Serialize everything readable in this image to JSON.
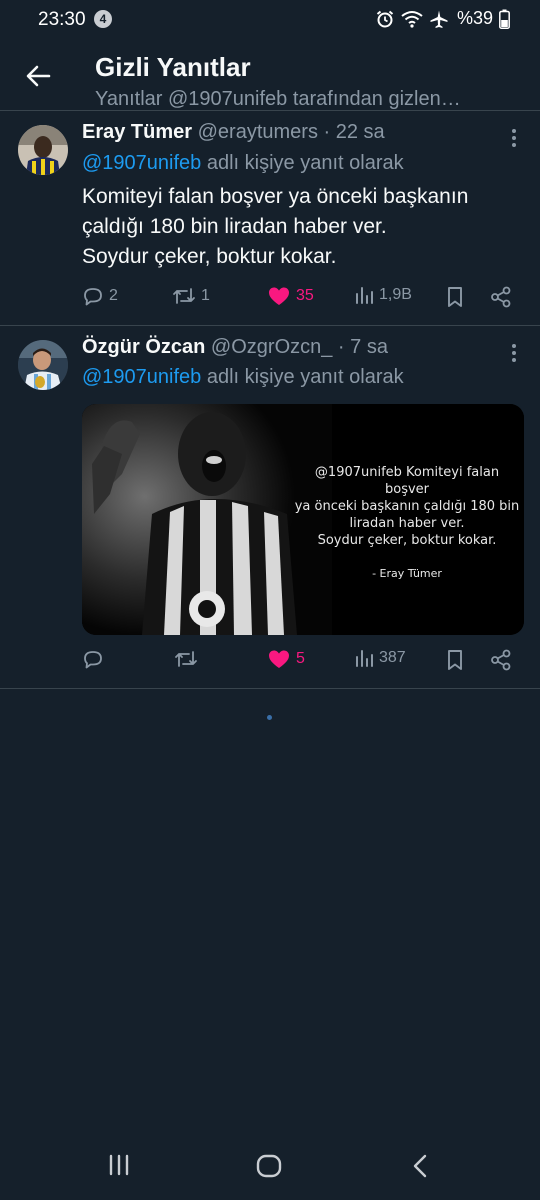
{
  "status_bar": {
    "time": "23:30",
    "notification_count": "4",
    "battery": "%39",
    "icons": [
      "alarm-icon",
      "wifi-icon",
      "airplane-icon",
      "battery-icon"
    ]
  },
  "header": {
    "title": "Gizli Yanıtlar",
    "subtitle": "Yanıtlar @1907unifeb tarafından gizlen…"
  },
  "tweets": [
    {
      "name": "Eray Tümer",
      "meta": "@eraytumers · 22 sa",
      "reply_to": "@1907unifeb",
      "reply_suffix": " adlı kişiye yanıt olarak",
      "body_lines": [
        "Komiteyi falan boşver ya önceki başkanın",
        "çaldığı 180 bin liradan haber ver.",
        "Soydur çeker, boktur kokar."
      ],
      "replies": "2",
      "retweets": "1",
      "likes": "35",
      "views": "1,9B"
    },
    {
      "name": "Özgür Özcan",
      "meta": "@OzgrOzcn_ · 7 sa",
      "reply_to": "@1907unifeb",
      "reply_suffix": " adlı kişiye yanıt olarak",
      "media_text_lines": [
        "@1907unifeb Komiteyi falan boşver",
        "ya önceki başkanın çaldığı 180 bin",
        "liradan haber ver.",
        "Soydur çeker, boktur kokar."
      ],
      "media_signature": "- Eray Tümer",
      "replies": "",
      "retweets": "",
      "likes": "5",
      "views": "387"
    }
  ],
  "colors": {
    "background": "#15202b",
    "accent": "#1d9bf0",
    "like": "#f91880",
    "muted": "#8b98a5",
    "divider": "#38444d"
  }
}
